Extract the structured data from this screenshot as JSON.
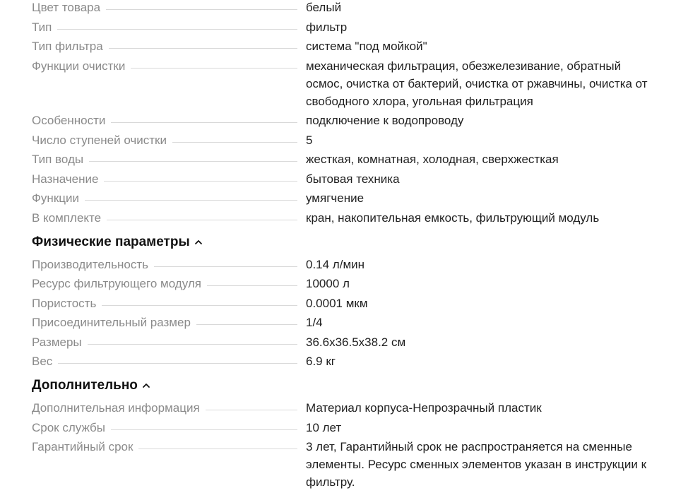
{
  "group1": [
    {
      "label": "Цвет товара",
      "value": "белый"
    },
    {
      "label": "Тип",
      "value": "фильтр"
    },
    {
      "label": "Тип фильтра",
      "value": "система \"под мойкой\""
    },
    {
      "label": "Функции очистки",
      "value": "механическая фильтрация, обезжелезивание, обратный осмос, очистка от бактерий, очистка от ржавчины, очистка от свободного хлора, угольная фильтрация"
    },
    {
      "label": "Особенности",
      "value": "подключение к водопроводу"
    },
    {
      "label": "Число ступеней очистки",
      "value": "5"
    },
    {
      "label": "Тип воды",
      "value": "жесткая, комнатная, холодная, сверхжесткая"
    },
    {
      "label": "Назначение",
      "value": "бытовая техника"
    },
    {
      "label": "Функции",
      "value": "умягчение"
    },
    {
      "label": "В комплекте",
      "value": "кран, накопительная емкость, фильтрующий модуль"
    }
  ],
  "section_physical": {
    "title": "Физические параметры",
    "icon": "chevron-up-icon",
    "rows": [
      {
        "label": "Производительность",
        "value": "0.14 л/мин"
      },
      {
        "label": "Ресурс фильтрующего модуля",
        "value": "10000 л"
      },
      {
        "label": "Пористость",
        "value": "0.0001 мкм"
      },
      {
        "label": "Присоединительный размер",
        "value": "1/4"
      },
      {
        "label": "Размеры",
        "value": "36.6x36.5x38.2 см"
      },
      {
        "label": "Вес",
        "value": "6.9 кг"
      }
    ]
  },
  "section_extra": {
    "title": "Дополнительно",
    "icon": "chevron-up-icon",
    "rows": [
      {
        "label": "Дополнительная информация",
        "value": "Материал корпуса-Непрозрачный пластик"
      },
      {
        "label": "Срок службы",
        "value": "10 лет"
      },
      {
        "label": "Гарантийный срок",
        "value": "3 лет, Гарантийный срок не распространяется на сменные элементы. Ресурс сменных элементов указан в инструкции к фильтру."
      }
    ]
  }
}
